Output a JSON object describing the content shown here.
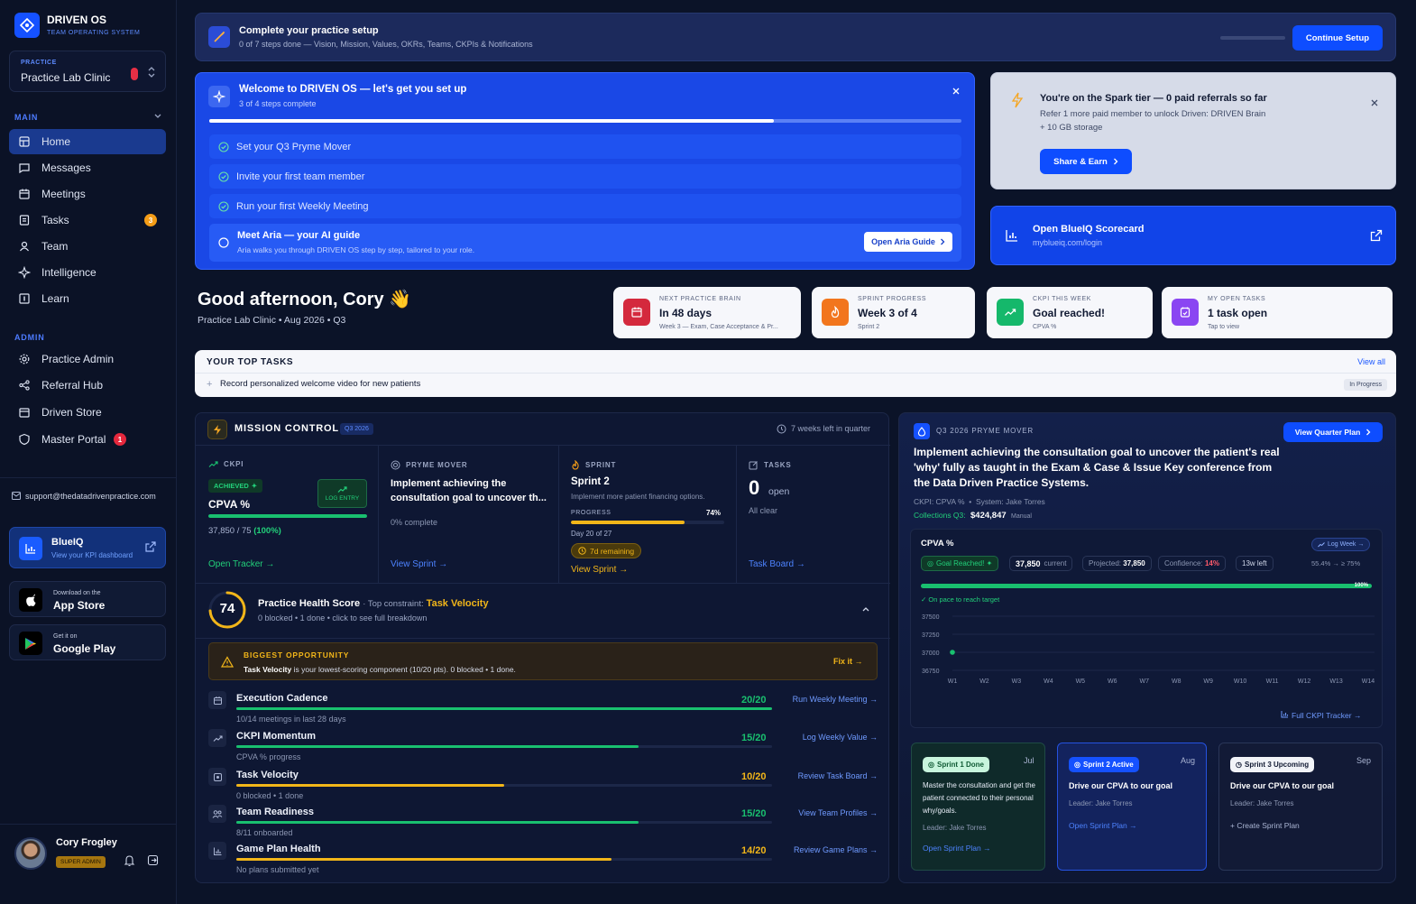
{
  "brand": {
    "name": "DRIVEN OS",
    "tagline": "TEAM OPERATING SYSTEM"
  },
  "practice": {
    "label": "PRACTICE",
    "name": "Practice Lab Clinic"
  },
  "nav_main": {
    "label": "MAIN",
    "items": [
      {
        "label": "Home",
        "icon": "home-icon"
      },
      {
        "label": "Messages",
        "icon": "message-icon"
      },
      {
        "label": "Meetings",
        "icon": "calendar-icon"
      },
      {
        "label": "Tasks",
        "icon": "tasks-icon",
        "badge": "3"
      },
      {
        "label": "Team",
        "icon": "team-icon"
      },
      {
        "label": "Intelligence",
        "icon": "intelligence-icon"
      },
      {
        "label": "Learn",
        "icon": "learn-icon"
      }
    ]
  },
  "nav_admin": {
    "label": "ADMIN",
    "items": [
      {
        "label": "Practice Admin",
        "icon": "gear-icon"
      },
      {
        "label": "Referral Hub",
        "icon": "share-icon"
      },
      {
        "label": "Driven Store",
        "icon": "store-icon"
      },
      {
        "label": "Master Portal",
        "icon": "shield-icon",
        "badge": "1"
      }
    ]
  },
  "support_email": "support@thedatadrivenpractice.com",
  "blueiq": {
    "title": "BlueIQ",
    "sub": "View your KPI dashboard"
  },
  "app_store": {
    "small": "Download on the",
    "big": "App Store"
  },
  "google_play": {
    "small": "Get it on",
    "big": "Google Play"
  },
  "user": {
    "name": "Cory Frogley",
    "role": "SUPER ADMIN"
  },
  "setup_banner": {
    "title": "Complete your practice setup",
    "sub": "0 of 7 steps done — Vision, Mission, Values, OKRs, Teams, CKPIs & Notifications",
    "button": "Continue Setup",
    "progress": 0
  },
  "welcome": {
    "title": "Welcome to DRIVEN OS — let's get you set up",
    "sub": "3 of 4 steps complete",
    "progress": 0.75,
    "steps": [
      "Set your Q3 Pryme Mover",
      "Invite your first team member",
      "Run your first Weekly Meeting"
    ],
    "aria_title": "Meet Aria — your AI guide",
    "aria_sub": "Aria walks you through DRIVEN OS step by step, tailored to your role.",
    "aria_button": "Open Aria Guide"
  },
  "spark": {
    "title": "You're on the Spark tier — 0 paid referrals so far",
    "line1": "Refer 1 more paid member to unlock Driven: DRIVEN Brain",
    "line2": "+ 10 GB storage",
    "button": "Share & Earn"
  },
  "blueiq_card": {
    "title": "Open BlueIQ Scorecard",
    "url": "myblueiq.com/login"
  },
  "greeting": {
    "title": "Good afternoon, Cory 👋",
    "sub": "Practice Lab Clinic • Aug 2026 • Q3"
  },
  "stats": [
    {
      "label": "NEXT PRACTICE BRAIN",
      "value": "In 48 days",
      "sub": "Week 3 — Exam, Case Acceptance & Pr...",
      "color": "#d4293d",
      "icon": "calendar-icon"
    },
    {
      "label": "SPRINT PROGRESS",
      "value": "Week 3 of 4",
      "sub": "Sprint 2",
      "color": "#f2761d",
      "icon": "flame-icon"
    },
    {
      "label": "CKPI THIS WEEK",
      "value": "Goal reached!",
      "sub": "CPVA %",
      "color": "#15b86b",
      "icon": "trend-icon"
    },
    {
      "label": "MY OPEN TASKS",
      "value": "1 task open",
      "sub": "Tap to view",
      "color": "#8a46f2",
      "icon": "task-icon"
    }
  ],
  "top_tasks": {
    "title": "YOUR TOP TASKS",
    "view_all": "View all",
    "items": [
      {
        "text": "Record personalized welcome video for new patients",
        "status": "In Progress"
      }
    ]
  },
  "mission": {
    "title": "MISSION CONTROL",
    "quarter": "Q3 2026",
    "weeks_left": "7 weeks left in quarter",
    "ckpi": {
      "label": "CKPI",
      "badge": "ACHIEVED",
      "name": "CPVA %",
      "log": "LOG ENTRY",
      "progress": 1.0,
      "value": "37,850 / 75",
      "pct": "(100%)",
      "link": "Open Tracker"
    },
    "pryme": {
      "label": "PRYME MOVER",
      "text": "Implement achieving the consultation goal to uncover th...",
      "complete": "0% complete",
      "link": "View Sprint"
    },
    "sprint": {
      "label": "SPRINT",
      "name": "Sprint 2",
      "desc": "Implement more patient financing options.",
      "progress_label": "PROGRESS",
      "progress_pct": "74%",
      "progress": 0.74,
      "day": "Day 20 of 27",
      "remaining": "7d remaining",
      "link": "View Sprint"
    },
    "tasks": {
      "label": "TASKS",
      "count": "0",
      "count_label": "open",
      "sub": "All clear",
      "link": "Task Board"
    }
  },
  "health": {
    "score": "74",
    "score_value": 74,
    "title": "Practice Health Score",
    "constraint_prefix": "· Top constraint:",
    "constraint": "Task Velocity",
    "sub": "0 blocked • 1 done • click to see full breakdown",
    "opp_title": "BIGGEST OPPORTUNITY",
    "opp_bold": "Task Velocity",
    "opp_text": "is your lowest-scoring component (10/20 pts). 0 blocked • 1 done.",
    "opp_link": "Fix it",
    "rows": [
      {
        "title": "Execution Cadence",
        "sub": "10/14 meetings in last 28 days",
        "score": "20/20",
        "value": 1.0,
        "color": "#19c06f",
        "action": "Run Weekly Meeting",
        "icon": "calendar-icon"
      },
      {
        "title": "CKPI Momentum",
        "sub": "CPVA % progress",
        "score": "15/20",
        "value": 0.75,
        "color": "#19c06f",
        "action": "Log Weekly Value",
        "icon": "trend-icon"
      },
      {
        "title": "Task Velocity",
        "sub": "0 blocked • 1 done",
        "score": "10/20",
        "value": 0.5,
        "color": "#f2b619",
        "action": "Review Task Board",
        "icon": "task-icon"
      },
      {
        "title": "Team Readiness",
        "sub": "8/11 onboarded",
        "score": "15/20",
        "value": 0.75,
        "color": "#19c06f",
        "action": "View Team Profiles",
        "icon": "team-icon"
      },
      {
        "title": "Game Plan Health",
        "sub": "No plans submitted yet",
        "score": "14/20",
        "value": 0.7,
        "color": "#f2b619",
        "action": "Review Game Plans",
        "icon": "chart-icon"
      }
    ]
  },
  "pryme_panel": {
    "label": "Q3 2026 PRYME MOVER",
    "button": "View Quarter Plan",
    "text": "Implement achieving the consultation goal to uncover the patient's real 'why' fully as taught in the Exam & Case & Issue Key conference from the Data Driven Practice Systems.",
    "ckpi": "CKPI: CPVA %",
    "system": "System: Jake Torres",
    "collections_label": "Collections Q3:",
    "collections": "$424,847",
    "collections_tag": "Manual"
  },
  "cpva": {
    "title": "CPVA %",
    "log_button": "Log Week",
    "goal": "Goal Reached!",
    "current": "37,850",
    "current_label": "current",
    "projected_label": "Projected:",
    "projected": "37,850",
    "confidence_label": "Confidence:",
    "confidence": "14%",
    "weeks_left": "13w left",
    "trend": "55.4% → ≥ 75%",
    "bar_value": 1.0,
    "bar_label": "100%",
    "on_pace": "On pace to reach target",
    "footer_link": "Full CKPI Tracker"
  },
  "chart_data": {
    "type": "scatter",
    "title": "CPVA %",
    "xlabel": "",
    "ylabel": "",
    "x": [
      "W1",
      "W2",
      "W3",
      "W4",
      "W5",
      "W6",
      "W7",
      "W8",
      "W9",
      "W10",
      "W11",
      "W12",
      "W13",
      "W14"
    ],
    "yticks": [
      37500,
      37250,
      37000,
      36750
    ],
    "ylim": [
      36750,
      37500
    ],
    "series": [
      {
        "points": [
          {
            "x": "W1",
            "y": 37000
          }
        ]
      }
    ]
  },
  "sprints": [
    {
      "badge": "Sprint 1 Done",
      "month": "Jul",
      "text": "Master the consultation and get the patient connected to their personal why/goals.",
      "leader": "Leader: Jake Torres",
      "link": "Open Sprint Plan"
    },
    {
      "badge": "Sprint 2 Active",
      "month": "Aug",
      "text": "Drive our CPVA to our goal",
      "leader": "Leader: Jake Torres",
      "link": "Open Sprint Plan"
    },
    {
      "badge": "Sprint 3 Upcoming",
      "month": "Sep",
      "text": "Drive our CPVA to our goal",
      "leader": "Leader: Jake Torres",
      "link": "+ Create Sprint Plan"
    }
  ]
}
